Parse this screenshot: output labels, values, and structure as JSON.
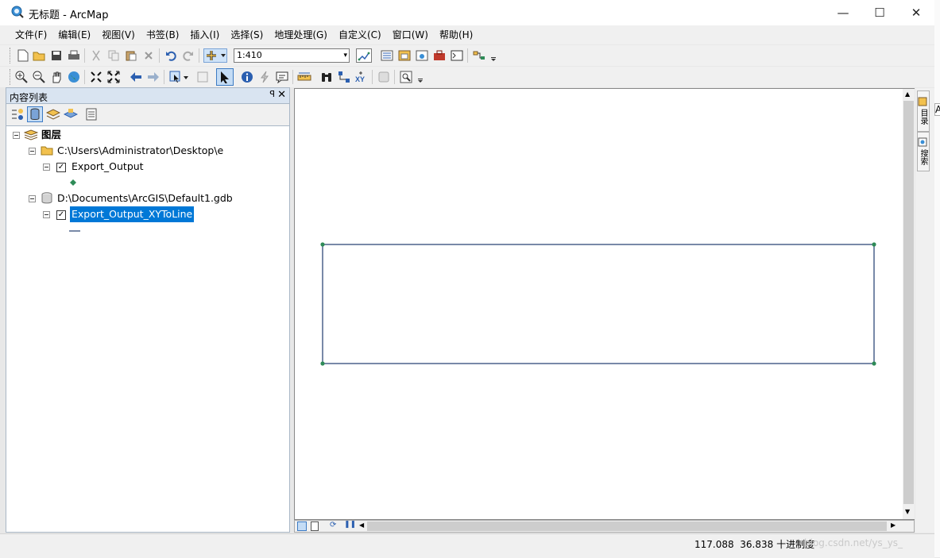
{
  "window": {
    "title": "无标题 - ArcMap",
    "minimize_glyph": "—",
    "maximize_glyph": "☐",
    "close_glyph": "✕"
  },
  "menu": [
    "文件(F)",
    "编辑(E)",
    "视图(V)",
    "书签(B)",
    "插入(I)",
    "选择(S)",
    "地理处理(G)",
    "自定义(C)",
    "窗口(W)",
    "帮助(H)"
  ],
  "toolbar": {
    "scale_value": "1:410",
    "scale_dropdown_glyph": "▾"
  },
  "toc": {
    "title": "内容列表",
    "pin_glyph": "ꟼ",
    "close_glyph": "✕",
    "root_label": "图层",
    "folder_label": "C:\\Users\\Administrator\\Desktop\\e",
    "layer1_label": "Export_Output",
    "gdb_label": "D:\\Documents\\ArcGIS\\Default1.gdb",
    "layer2_label": "Export_Output_XYToLine",
    "check_glyph": "✓"
  },
  "map": {
    "scroll_up": "▲",
    "scroll_down": "▼",
    "scroll_left": "◀",
    "scroll_right": "▶",
    "line_color": "#1f3b6e",
    "vertex_color": "#2e8b57"
  },
  "right_dock": {
    "tab1_label": "目录",
    "tab2_label": "搜索",
    "peek_text": "Ar"
  },
  "status": {
    "x": "117.088",
    "y": "36.838",
    "units": "十进制度",
    "watermark": "blog.csdn.net/ys_ys_"
  },
  "colors": {
    "selection": "#0078d7",
    "toc_header": "#d9e4f1"
  }
}
